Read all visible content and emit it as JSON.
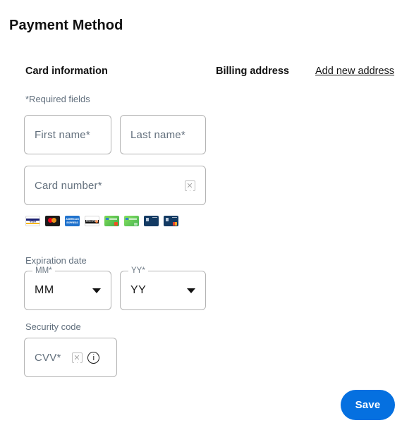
{
  "page": {
    "title": "Payment Method"
  },
  "sections": {
    "card_information": {
      "heading": "Card information",
      "required_note": "*Required fields"
    },
    "billing_address": {
      "heading": "Billing address",
      "add_new_link": "Add new address"
    }
  },
  "fields": {
    "first_name": {
      "placeholder": "First name*",
      "value": ""
    },
    "last_name": {
      "placeholder": "Last name*",
      "value": ""
    },
    "card_number": {
      "placeholder": "Card number*",
      "value": "",
      "icon": "broken-image-icon"
    },
    "expiration": {
      "label": "Expiration date",
      "month": {
        "notch_label": "MM*",
        "value": "MM",
        "icon": "chevron-down-icon"
      },
      "year": {
        "notch_label": "YY*",
        "value": "YY",
        "icon": "chevron-down-icon"
      }
    },
    "security_code": {
      "label": "Security code",
      "placeholder": "CVV*",
      "value": "",
      "icons": [
        "broken-image-icon",
        "info-circle-icon"
      ]
    }
  },
  "card_brands": [
    {
      "name": "visa",
      "label": "VISA"
    },
    {
      "name": "mastercard",
      "label": ""
    },
    {
      "name": "amex",
      "label": "AMERICAN EXPRESS"
    },
    {
      "name": "discover",
      "label": "DISCOVER"
    },
    {
      "name": "green-card-1",
      "label": ""
    },
    {
      "name": "green-card-2",
      "label": ""
    },
    {
      "name": "navy-card-1",
      "label": ""
    },
    {
      "name": "navy-card-2",
      "label": ""
    }
  ],
  "actions": {
    "save_label": "Save"
  },
  "colors": {
    "accent_blue": "#0570e0",
    "border_gray": "#b4b4b4",
    "placeholder_gray": "#63707d",
    "text_black": "#111111"
  }
}
